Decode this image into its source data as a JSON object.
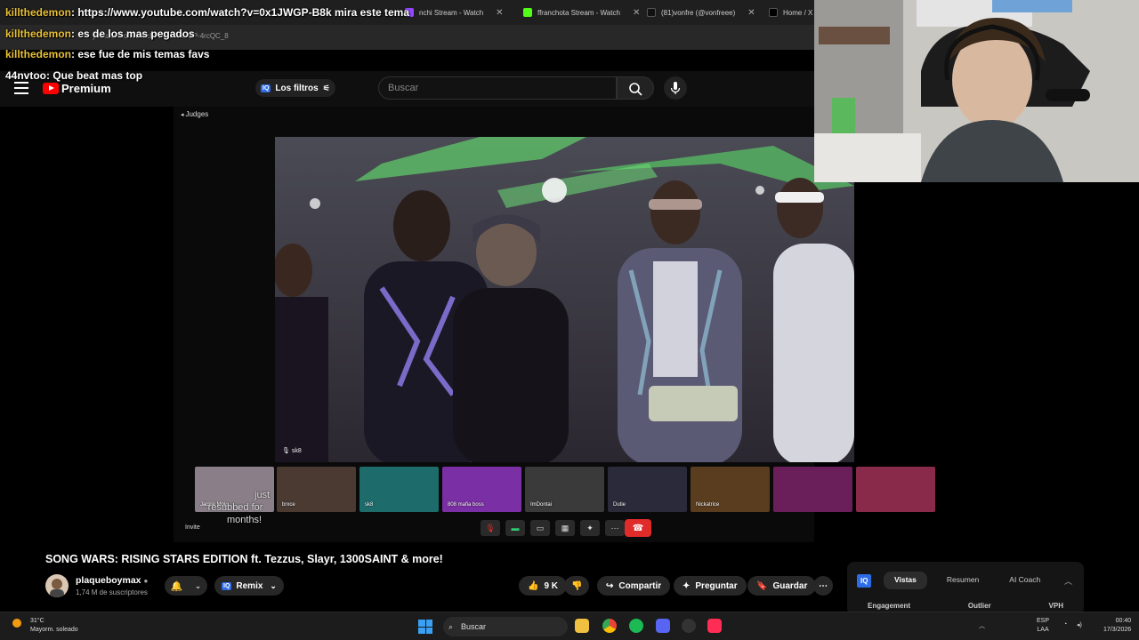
{
  "browser": {
    "tabs": [
      {
        "title": "nchi Stream - Watch",
        "color": "#9146ff"
      },
      {
        "title": "ffranchota Stream - Watch",
        "color": "#53fc18"
      },
      {
        "title": "(81)vonfre (@vonfreee)",
        "color": "#111111"
      },
      {
        "title": "Home / X",
        "color": "#000000"
      }
    ],
    "url_text": "youtube.com/watch?v=0x1JWGP-4rcQC_8"
  },
  "chat": [
    {
      "user": "killthedemon",
      "msg": ": https://www.youtube.com/watch?v=0x1JWGP-B8k mira este tema"
    },
    {
      "user": "killthedemon",
      "msg": ": es de los mas pegados"
    },
    {
      "user": "killthedemon",
      "msg": ": ese fue de mis temas favs"
    },
    {
      "user": "44nvtoo",
      "msg": ": Que beat mas top"
    }
  ],
  "youtube": {
    "logo_text": "Premium",
    "filters_label": "Los filtros",
    "iq_label": "IQ",
    "search_placeholder": "Buscar"
  },
  "player": {
    "room_label": "Judges",
    "main_label": "sk8",
    "participants": [
      {
        "name": "Jackie Mojo",
        "color": "#8a7f88"
      },
      {
        "name": "brxce",
        "color": "#4a3a32"
      },
      {
        "name": "sk8",
        "color": "#1e6b6b"
      },
      {
        "name": "808 mafia boss",
        "color": "#7b2fa5"
      },
      {
        "name": "ImDontai",
        "color": "#3a3a3a"
      },
      {
        "name": "Dutie",
        "color": "#2a2a3a"
      },
      {
        "name": "Nickatrice",
        "color": "#5a3c1e"
      },
      {
        "name": "",
        "color": "#6b1f5a"
      },
      {
        "name": "",
        "color": "#8a2a4a"
      }
    ],
    "sub_overlay": [
      "just",
      "resubbed for",
      "months!"
    ],
    "invite_label": "Invite"
  },
  "video": {
    "title": "SONG WARS: RISING STARS EDITION ft. Tezzus, Slayr, 1300SAINT & more!",
    "channel": "plaqueboymax",
    "subscribers": "1,74 M de suscriptores",
    "remix_label": "Remix",
    "likes": "9 K",
    "share_label": "Compartir",
    "ask_label": "Preguntar",
    "save_label": "Guardar"
  },
  "sidepanel": {
    "tabs": [
      "Vistas",
      "Resumen",
      "AI Coach"
    ],
    "columns": [
      "Engagement",
      "Outlier",
      "VPH"
    ]
  },
  "taskbar": {
    "temp": "31°C",
    "weather": "Mayorm. soleado",
    "search": "Buscar",
    "lang1": "ESP",
    "lang2": "LAA",
    "time": "00:40",
    "date": "17/3/2026"
  }
}
